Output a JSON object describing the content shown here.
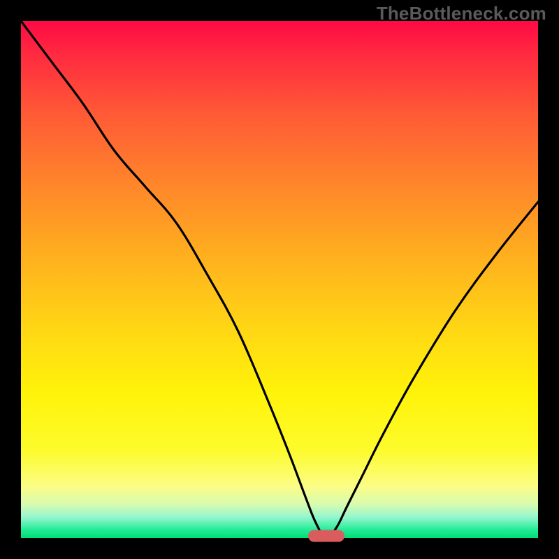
{
  "watermark": "TheBottleneck.com",
  "colors": {
    "frame": "#000000",
    "curve": "#000000",
    "marker": "#da5c5f",
    "gradient_top": "#ff0a44",
    "gradient_bottom": "#00e072"
  },
  "chart_data": {
    "type": "line",
    "title": "",
    "xlabel": "",
    "ylabel": "",
    "xlim": [
      0,
      100
    ],
    "ylim": [
      0,
      100
    ],
    "grid": false,
    "legend": false,
    "annotations": [
      "TheBottleneck.com"
    ],
    "marker": {
      "x": 59,
      "y": 0,
      "color": "#da5c5f",
      "shape": "pill"
    },
    "series": [
      {
        "name": "bottleneck-curve",
        "color": "#000000",
        "x": [
          0,
          6,
          12,
          18,
          24,
          30,
          36,
          42,
          48,
          52,
          55,
          57,
          59,
          61,
          63,
          66,
          70,
          76,
          84,
          92,
          100
        ],
        "y": [
          100,
          92,
          84,
          75,
          68,
          61,
          51,
          40,
          26,
          16,
          8,
          3,
          0,
          2,
          6,
          12,
          20,
          31,
          44,
          55,
          65
        ]
      }
    ]
  }
}
